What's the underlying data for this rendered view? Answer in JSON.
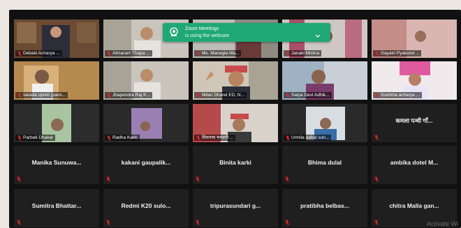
{
  "banner": {
    "title": "Zoom Meetings",
    "subtitle": "is using the webcam"
  },
  "rows": [
    [
      {
        "name": "Debaki Acharya ...",
        "type": "video",
        "scene": "shelf"
      },
      {
        "name": "Atmaram Thapa ...",
        "type": "video",
        "scene": "room"
      },
      {
        "name": "Ms. Managla Ma...",
        "type": "video",
        "scene": "room2"
      },
      {
        "name": "Janaki Mishra",
        "type": "video",
        "scene": "curtain"
      },
      {
        "name": "Gayatri Pyakurel ...",
        "type": "video",
        "scene": "pink"
      }
    ],
    [
      {
        "name": "sarada upreti (panc...",
        "type": "video",
        "scene": "warm"
      },
      {
        "name": "Jhapendra Raj K...",
        "type": "video",
        "scene": "room"
      },
      {
        "name": "Milan Dharel ED, N...",
        "type": "video",
        "scene": "hat",
        "active": true
      },
      {
        "name": "Satya Devi Adhik...",
        "type": "video",
        "scene": "blue"
      },
      {
        "name": "Sushma acharya ...",
        "type": "video",
        "scene": "pink2"
      }
    ],
    [
      {
        "name": "Parbati Dhakal",
        "type": "video",
        "scene": "green"
      },
      {
        "name": "Radha Karki",
        "type": "video",
        "scene": "purple"
      },
      {
        "name": "शिवनाथ भण्डारी ...",
        "type": "video",
        "scene": "hat2"
      },
      {
        "name": "Urmila dahal sun...",
        "type": "video",
        "scene": "blue2"
      },
      {
        "name": "कमला पन्थी गाँ...",
        "type": "text"
      }
    ],
    [
      {
        "name": "Manika Sunuwa...",
        "type": "text"
      },
      {
        "name": "kakani gaupalik...",
        "type": "text"
      },
      {
        "name": "Binita karki",
        "type": "text"
      },
      {
        "name": "Bhima dulal",
        "type": "text"
      },
      {
        "name": "ambika dotel M...",
        "type": "text"
      }
    ],
    [
      {
        "name": "Sumitra Bhattar...",
        "type": "text"
      },
      {
        "name": "Redmi K20 sulo...",
        "type": "text"
      },
      {
        "name": "tripurasundari g...",
        "type": "text"
      },
      {
        "name": "pratibha belbas...",
        "type": "text"
      },
      {
        "name": "chitra Malla gan...",
        "type": "text"
      }
    ]
  ],
  "watermark": "Activate Wi",
  "colors": {
    "banner": "#1fa876",
    "active_border": "#7ac143",
    "muted_mic": "#e0262b"
  }
}
